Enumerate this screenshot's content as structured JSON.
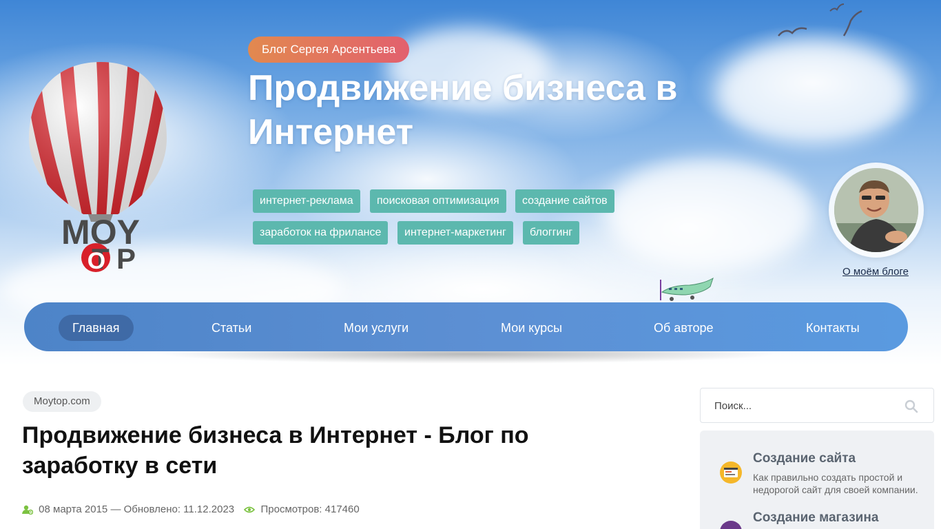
{
  "header": {
    "blog_pill": "Блог Сергея Арсентьева",
    "site_title": "Продвижение бизнеса в Интернет",
    "logo_text": "MOYTOP",
    "tags": [
      "интернет-реклама",
      "поисковая оптимизация",
      "создание сайтов",
      "заработок на фрилансе",
      "интернет-маркетинг",
      "блоггинг"
    ],
    "about_link": "О моём блоге"
  },
  "nav": {
    "items": [
      "Главная",
      "Статьи",
      "Мои услуги",
      "Мои курсы",
      "Об авторе",
      "Контакты"
    ],
    "active_index": 0
  },
  "content": {
    "breadcrumb": "Moytop.com",
    "title": "Продвижение бизнеса в Интернет - Блог по заработку в сети",
    "meta_date": "08 марта 2015 — Обновлено: 11.12.2023",
    "meta_views": "Просмотров: 417460"
  },
  "sidebar": {
    "search_placeholder": "Поиск...",
    "services": [
      {
        "title": "Создание сайта",
        "desc": "Как правильно создать простой и недорогой сайт для своей компании.",
        "icon": "browser-icon"
      },
      {
        "title": "Создание магазина",
        "desc": "",
        "icon": "shop-icon"
      }
    ]
  },
  "colors": {
    "nav_bg": "#5a8fd3",
    "nav_active": "#3f6aa6",
    "tag_bg": "#5cb8ae",
    "pill_start": "#e2894f",
    "pill_end": "#e2606e",
    "meta_icon": "#7cc241"
  }
}
